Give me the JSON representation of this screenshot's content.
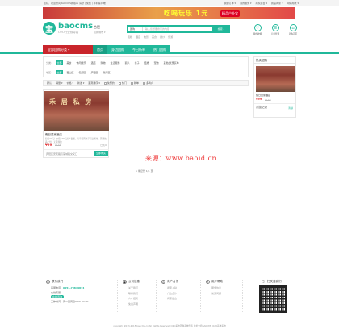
{
  "topbar": {
    "welcome": "您好，欢迎访问BAOCMS新版本  请登 | 免费 | 手机客户端",
    "links": [
      "我的订单",
      "我的服务",
      "商家后台",
      "我是商家",
      "网站导航"
    ]
  },
  "banner": {
    "headline": "吃喝玩乐 1元",
    "tag": "精品户外宝"
  },
  "logo": {
    "mark": "宝",
    "name": "baocms",
    "slogan": "O2O行业领导者"
  },
  "city": {
    "name": "合肥",
    "switch": "切换城市 ▾"
  },
  "search": {
    "type": "团购",
    "placeholder": "输入您想要搜索的内容",
    "button": "搜索"
  },
  "hot_words": [
    "蛋糕",
    "酒店",
    "电影",
    "美食",
    "婚纱",
    "旅游"
  ],
  "header_icons": [
    {
      "glyph": "♡",
      "label": "我的收藏"
    },
    {
      "glyph": "☰",
      "label": "订单管理"
    },
    {
      "glyph": "⌂",
      "label": "团购首页"
    }
  ],
  "nav": {
    "category_button": "全部团购分类 ▾",
    "links": [
      "首页",
      "身边团购",
      "今日新单",
      "热门团购"
    ]
  },
  "filters": {
    "row1_label": "分类:",
    "row1": [
      "全部",
      "美食",
      "休闲娱乐",
      "酒店",
      "购物",
      "生活服务",
      "丽人",
      "亲子",
      "结婚",
      "宠物",
      "其他/优惠买单"
    ],
    "row2_label": "地区:",
    "row2": [
      "全部",
      "蜀山区",
      "包河区",
      "庐阳区",
      "瑶海区"
    ]
  },
  "sortbar": {
    "sorts": [
      "默认",
      "销量 ▾",
      "价格 ▾",
      "新发 ▾",
      "距离排序 ▾"
    ],
    "checks": [
      "免预约",
      "热门",
      "新单",
      "多商户"
    ]
  },
  "deal": {
    "title": "假日皇家酒店",
    "desc": "仅售99元！价值168元双人套餐，可享受周末节假日通用，另赠饮品一份，无需预约",
    "price": "¥99",
    "old_price": "¥168",
    "sold": "已售0",
    "shop_note": "庐阳区安庆路与蒙城路交叉口",
    "button": "立即购买",
    "sign": "禾 居 私 房"
  },
  "pagination": "1 条记录 1/1 页",
  "watermark": "来源：www.baoid.cn",
  "sidebar": {
    "title": "热卖团购",
    "deal_title": "假日皇家酒店",
    "price": "¥99",
    "old_price": "¥168",
    "section2": "浏览记录",
    "more": "清除"
  },
  "footer": {
    "contact": {
      "title": "联系我们",
      "phone_label": "客服电话：",
      "phone": "0551-79879874",
      "online_label": "在线客服：",
      "online_btn": "在线咨询",
      "hours": "工作时间：周一至周日9:00-22:00"
    },
    "col2": {
      "title": "公司信息",
      "items": [
        "关于我们",
        "联系我们",
        "人才招聘",
        "免责声明"
      ]
    },
    "col3": {
      "title": "商户合作",
      "items": [
        "商家入驻",
        "广告合作",
        "商家后台"
      ]
    },
    "col4": {
      "title": "用户帮助",
      "items": [
        "服务协议",
        "常见问题"
      ]
    },
    "qr_title": "扫一扫关注我们"
  },
  "copyright": "copyright 2013-2015 baocms.cn All Rights Reserved O2O系统团购系统所有  技术支持BAOCMS O2O系统系统"
}
